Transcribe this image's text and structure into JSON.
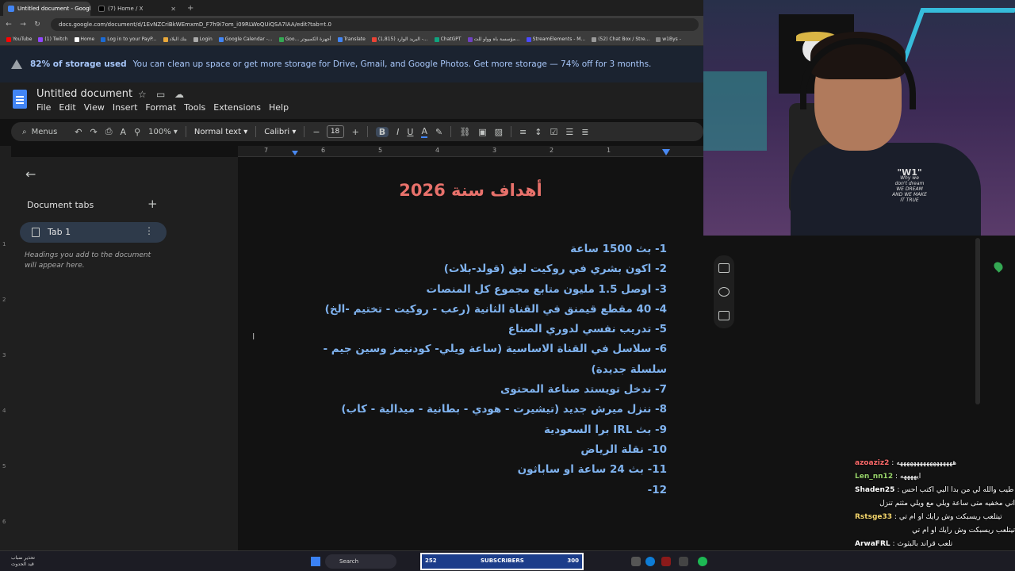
{
  "browser": {
    "tabs": [
      {
        "label": "Untitled document - Google Docs",
        "active": true,
        "color": "#4285f4"
      },
      {
        "label": "(7) Home / X",
        "active": false,
        "color": "#000000"
      }
    ],
    "url": "docs.google.com/document/d/1EvNZCriBkWEmxmD_F7h9i7om_i09RLWoQUiQSA7IAA/edit?tab=t.0",
    "bookmarks": [
      "YouTube",
      "(1) Twitch",
      "Home",
      "Log in to your PayP...",
      "بنك البلاد",
      "Login",
      "Google Calendar -...",
      "Goo... أجهزة الكمبيوتر",
      "Translate",
      "(1,815) البريد الوارد -...",
      "ChatGPT",
      "مؤسسة باه وواو للت...",
      "StreamElements - M...",
      "(52) Chat Box / Stre...",
      "w1Bys -"
    ]
  },
  "banner": {
    "bold": "82% of storage used",
    "message": "You can clean up space or get more storage for Drive, Gmail, and Google Photos. Get more storage — 74% off for 3 months."
  },
  "docs": {
    "title": "Untitled document",
    "menu": [
      "File",
      "Edit",
      "View",
      "Insert",
      "Format",
      "Tools",
      "Extensions",
      "Help"
    ],
    "toolbar": {
      "menus": "Menus",
      "zoom": "100%",
      "style": "Normal text",
      "font": "Calibri",
      "font_size": "18"
    },
    "ruler": [
      "7",
      "6",
      "5",
      "4",
      "3",
      "2",
      "1"
    ],
    "left_ruler": [
      "1",
      "2",
      "3",
      "4",
      "5",
      "6"
    ],
    "sidebar": {
      "heading": "Document tabs",
      "tab_label": "Tab 1",
      "hint": "Headings you add to the document will appear here."
    }
  },
  "document": {
    "heading": "أهداف سنة 2026",
    "goals": [
      "1- بث 1500 ساعة",
      "2- اكون بشري في روكيت ليق (قولد-بلات)",
      "3- اوصل 1.5 مليون متابع مجموع كل المنصات",
      "4- 40 مقطع قيمنق في القناة الثانية (رعب - روكيت - تختيم -الخ)",
      "5- تدريب نفسي لدوري الصناع",
      "6- سلاسل في القناة الاساسية (ساعة ويلي- كودنيمز وسين جيم - سلسلة جديدة)",
      "7- ندخل تويستد صناعة المحتوى",
      "8- ننزل ميرش جديد (تيشيرت - هودي - بطانية - ميدالية - كاب)",
      "9- بث IRL برا السعودية",
      "10- نقلة الرياض",
      "11- بث 24 ساعة او ساباثون",
      "12-"
    ]
  },
  "webcam": {
    "shirt_small_top": "\"W1\"",
    "shirt_lines": [
      "Why we",
      "don't dream",
      "WE DREAM",
      "AND WE MAKE",
      "IT TRUE"
    ]
  },
  "chat": [
    {
      "user": "azoaziz2",
      "text": ": هههههههههههههههههه",
      "color": "#ff6b6b"
    },
    {
      "user": "Len_nn12",
      "text": ": ايههههه",
      "color": "#9ad66b"
    },
    {
      "user": "Shaden25",
      "text": ": طيب والله لي من بدا البي اكتب احس",
      "color": "#e3e3e3"
    },
    {
      "user": "",
      "text": "اني مخفيه متى ساعة ويلي مع ويلي مثتم تنزل",
      "color": "#e3e3e3"
    },
    {
      "user": "Rstsge33",
      "text": ": تيتلعب ريسبكت وش رايك او ام تي",
      "color": "#f5d76e"
    },
    {
      "user": "",
      "text": "تيتلعب ريسبكت وش رايك او ام تي",
      "color": "#e3e3e3"
    },
    {
      "user": "ArwaFRL",
      "text": ": تلعب قراند بالبثوث",
      "color": "#e3e3e3"
    }
  ],
  "taskbar": {
    "weather_line1": "تحذير ضباب",
    "weather_line2": "قيد الحدوث",
    "search": "Search",
    "subs_count": "252",
    "subs_label": "SUBSCRIBERS",
    "subs_goal": "300"
  }
}
